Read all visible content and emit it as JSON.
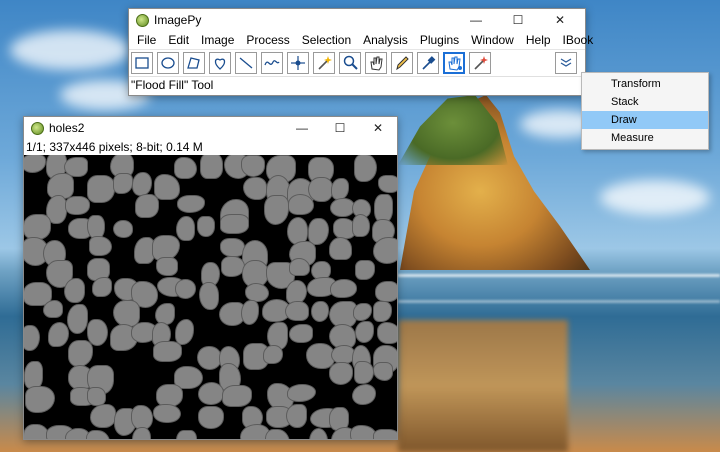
{
  "imagepy": {
    "title": "ImagePy",
    "menus": [
      "File",
      "Edit",
      "Image",
      "Process",
      "Selection",
      "Analysis",
      "Plugins",
      "Window",
      "Help",
      "IBook"
    ],
    "tools": [
      {
        "icon": "rectangle-icon"
      },
      {
        "icon": "ellipse-icon"
      },
      {
        "icon": "polygon-icon"
      },
      {
        "icon": "freehand-icon"
      },
      {
        "icon": "line-icon"
      },
      {
        "icon": "freeline-icon"
      },
      {
        "icon": "point-icon"
      },
      {
        "icon": "wand-icon"
      },
      {
        "icon": "magnifier-icon"
      },
      {
        "icon": "hand-icon"
      },
      {
        "icon": "pencil-icon"
      },
      {
        "icon": "eyedropper-icon"
      },
      {
        "icon": "flood-fill-icon",
        "active": true
      },
      {
        "icon": "magic-wand-icon"
      }
    ],
    "status": "\"Flood Fill\" Tool",
    "minimize": "—",
    "maximize": "☐",
    "close": "✕"
  },
  "dropdown": {
    "items": [
      "Transform",
      "Stack",
      "Draw",
      "Measure"
    ],
    "selected": "Draw"
  },
  "holes_window": {
    "title": "holes2",
    "info": "1/1;  337x446 pixels; 8-bit; 0.14 M",
    "minimize": "—",
    "maximize": "☐",
    "close": "✕"
  },
  "colors": {
    "accent": "#1b6fd6",
    "selection": "#91c9f7",
    "cell_fill": "#858585"
  }
}
